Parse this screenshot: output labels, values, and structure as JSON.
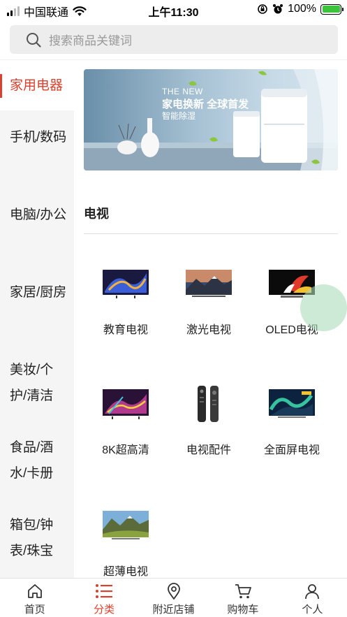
{
  "status_bar": {
    "carrier": "中国联通",
    "time": "上午11:30",
    "battery_percent": "100%",
    "battery_level": 1.0
  },
  "search": {
    "placeholder": "搜索商品关键词"
  },
  "sidebar": {
    "items": [
      {
        "label": "家用电器",
        "active": true
      },
      {
        "label": "手机/数码",
        "active": false
      },
      {
        "label": "电脑/办公",
        "active": false
      },
      {
        "label": "家居/厨房",
        "active": false
      },
      {
        "label": "美妆/个护/清洁",
        "active": false
      },
      {
        "label": "食品/酒水/卡册",
        "active": false
      },
      {
        "label": "箱包/钟表/珠宝",
        "active": false
      }
    ]
  },
  "banner": {
    "line1": "THE NEW",
    "line2": "家电换新 全球首发",
    "line3": "智能除湿"
  },
  "section": {
    "title": "电视",
    "products": [
      {
        "label": "教育电视",
        "icon": "tv-blue-abstract-icon"
      },
      {
        "label": "激光电视",
        "icon": "tv-mountain-icon"
      },
      {
        "label": "OLED电视",
        "icon": "tv-oled-colorful-icon"
      },
      {
        "label": "8K超高清",
        "icon": "tv-8k-icon"
      },
      {
        "label": "电视配件",
        "icon": "remote-control-icon"
      },
      {
        "label": "全面屏电视",
        "icon": "tv-aurora-icon"
      },
      {
        "label": "超薄电视",
        "icon": "tv-landscape-icon"
      }
    ]
  },
  "tabbar": {
    "items": [
      {
        "label": "首页",
        "icon": "home-icon",
        "active": false
      },
      {
        "label": "分类",
        "icon": "list-icon",
        "active": true
      },
      {
        "label": "附近店铺",
        "icon": "location-pin-icon",
        "active": false
      },
      {
        "label": "购物车",
        "icon": "cart-icon",
        "active": false
      },
      {
        "label": "个人",
        "icon": "person-icon",
        "active": false
      }
    ]
  },
  "colors": {
    "accent": "#d8412f",
    "sidebar_bg": "#f5f5f5",
    "search_bg": "#ededed"
  }
}
